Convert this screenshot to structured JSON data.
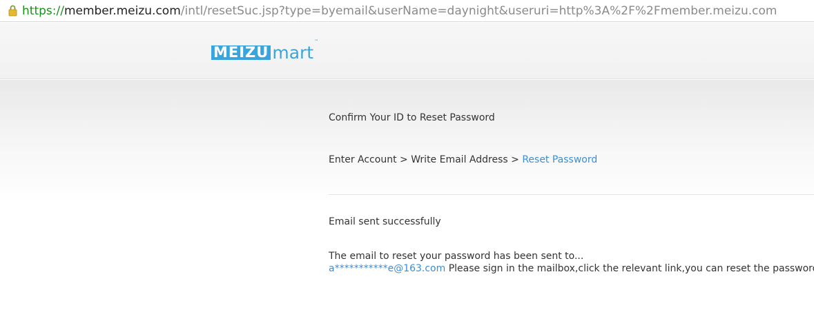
{
  "browser": {
    "url_scheme": "https://",
    "url_host": "member.meizu.com",
    "url_rest": "/intl/resetSuc.jsp?type=byemail&userName=daynight&useruri=http%3A%2F%2Fmember.meizu.com",
    "secure_icon": "lock-icon",
    "secure_color": "#1a8f1a"
  },
  "logo": {
    "brand": "MEIZU",
    "product": "mart",
    "trademark": "™",
    "color": "#3aa5dc"
  },
  "page": {
    "heading": "Confirm Your ID to Reset Password",
    "steps": {
      "step1": "Enter Account",
      "sep1": " > ",
      "step2": "Write Email Address",
      "sep2": " > ",
      "step3": "Reset Password",
      "active_color": "#3a8ed8"
    },
    "status": "Email sent successfully",
    "message_line1": "The email to reset your password has been sent to...",
    "email": "a***********e@163.com",
    "message_line2": " Please sign in the mailbox,click the relevant link,you can reset the password."
  }
}
